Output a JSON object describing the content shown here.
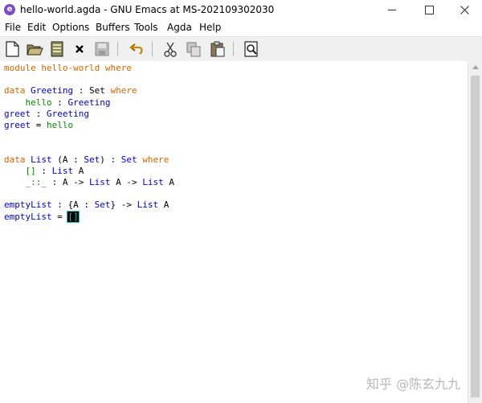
{
  "window": {
    "title": "hello-world.agda - GNU Emacs at MS-202109302030",
    "app_icon": "emacs-icon",
    "app_icon_glyph": "e"
  },
  "menu": [
    "File",
    "Edit",
    "Options",
    "Buffers",
    "Tools",
    "Agda",
    "Help"
  ],
  "toolbar": {
    "buttons": [
      "new-file-icon",
      "open-folder-icon",
      "save-dired-icon",
      "close-buffer-icon",
      "save-icon",
      "undo-icon",
      "cut-icon",
      "copy-icon",
      "paste-icon",
      "search-icon"
    ]
  },
  "editor": {
    "line_module_kw": "module",
    "line_module_name": "hello-world",
    "line_module_where": "where",
    "data1_kw": "data",
    "data1_name": "Greeting",
    "data1_sig": " : Set ",
    "data1_where": "where",
    "hello_name": "hello",
    "hello_sig": " : ",
    "hello_type": "Greeting",
    "greet_name": "greet",
    "greet_sig": " : ",
    "greet_type": "Greeting",
    "greet_def": "greet",
    "greet_eq": " = ",
    "greet_val": "hello",
    "data2_kw": "data",
    "data2_name": "List",
    "data2_params": " (A : ",
    "data2_set": "Set",
    "data2_rest": ") : ",
    "data2_set2": "Set",
    "data2_where": "where",
    "nil_name": "[]",
    "nil_sig": " : ",
    "nil_type": "List",
    "nil_arg": " A",
    "cons_name": "_::_",
    "cons_sig": " : A -> ",
    "cons_type1": "List",
    "cons_mid": " A -> ",
    "cons_type2": "List",
    "cons_end": " A",
    "empty_name": "emptyList",
    "empty_sig": " : {A : ",
    "empty_set": "Set",
    "empty_mid": "} -> ",
    "empty_type": "List",
    "empty_end": " A",
    "empty_def": "emptyList",
    "empty_eq": " = ",
    "cursor_text": "[]"
  },
  "watermark": "知乎 @陈玄九九",
  "colors": {
    "keyword": "#cd6600",
    "function": "#0000cd",
    "constructor": "#008b00",
    "cursor_hole": "#00c4c4"
  }
}
